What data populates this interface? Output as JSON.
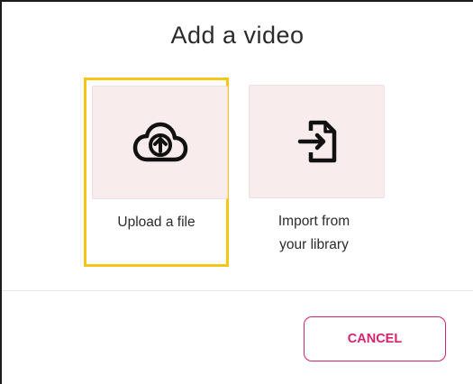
{
  "dialog": {
    "title": "Add a video"
  },
  "options": [
    {
      "label": "Upload a file",
      "icon": "cloud-upload-icon",
      "selected": true
    },
    {
      "label_line1": "Import from",
      "label_line2": "your library",
      "icon": "file-import-icon",
      "selected": false
    }
  ],
  "footer": {
    "cancel_label": "CANCEL"
  },
  "colors": {
    "accent": "#d3236f",
    "selection": "#f5c518",
    "tile": "#f9eced"
  }
}
